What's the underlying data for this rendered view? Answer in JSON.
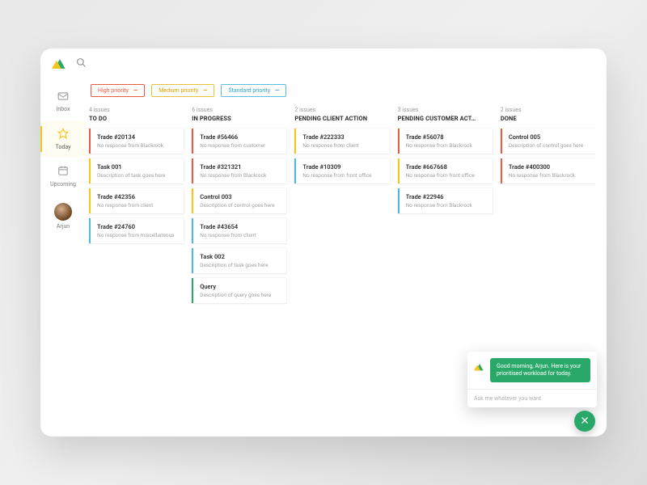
{
  "colors": {
    "high": "#e85c41",
    "medium": "#f5c518",
    "standard": "#4db8e0",
    "green": "#2aa86a"
  },
  "sidebar": {
    "items": [
      {
        "label": "Inbox"
      },
      {
        "label": "Today"
      },
      {
        "label": "Upcoming"
      }
    ],
    "user": {
      "name": "Arjun"
    }
  },
  "filters": [
    {
      "label": "High priority",
      "style": "high"
    },
    {
      "label": "Medium priority",
      "style": "med"
    },
    {
      "label": "Standard priority",
      "style": "std"
    }
  ],
  "columns": [
    {
      "count": "4 issues",
      "title": "TO DO",
      "cards": [
        {
          "title": "Trade #20134",
          "sub": "No response from Blackrock",
          "p": "high"
        },
        {
          "title": "Task 001",
          "sub": "Description of task goes here",
          "p": "med"
        },
        {
          "title": "Trade #42356",
          "sub": "No response from client",
          "p": "med"
        },
        {
          "title": "Trade #24760",
          "sub": "No response from miscellaneous",
          "p": "std"
        }
      ]
    },
    {
      "count": "6 issues",
      "title": "IN PROGRESS",
      "cards": [
        {
          "title": "Trade #56466",
          "sub": "No response from customer",
          "p": "high"
        },
        {
          "title": "Trade #321321",
          "sub": "No response from Blackrock",
          "p": "high"
        },
        {
          "title": "Control 003",
          "sub": "Description of control goes here",
          "p": "med"
        },
        {
          "title": "Trade #43654",
          "sub": "No response from client",
          "p": "std"
        },
        {
          "title": "Task 002",
          "sub": "Description of task goes here",
          "p": "std"
        },
        {
          "title": "Query",
          "sub": "Description of query goes here",
          "p": "green"
        }
      ]
    },
    {
      "count": "2 issues",
      "title": "PENDING CLIENT ACTION",
      "cards": [
        {
          "title": "Trade #222333",
          "sub": "No response from client",
          "p": "med"
        },
        {
          "title": "Trade #10309",
          "sub": "No response from front office",
          "p": "std"
        }
      ]
    },
    {
      "count": "3 issues",
      "title": "PENDING CUSTOMER ACT…",
      "cards": [
        {
          "title": "Trade #56078",
          "sub": "No response from Blackrock",
          "p": "high"
        },
        {
          "title": "Trade #667668",
          "sub": "No response from front office",
          "p": "med"
        },
        {
          "title": "Trade #22946",
          "sub": "No response from Blackrock",
          "p": "std"
        }
      ]
    },
    {
      "count": "2 issues",
      "title": "DONE",
      "cards": [
        {
          "title": "Control 005",
          "sub": "Description of control goes here",
          "p": "high"
        },
        {
          "title": "Trade #400300",
          "sub": "No response from Blackrock",
          "p": "high"
        }
      ]
    }
  ],
  "chat": {
    "message": "Good morning, Arjun. Here is your prioritised workload for today.",
    "placeholder": "Ask me whatever you want"
  }
}
